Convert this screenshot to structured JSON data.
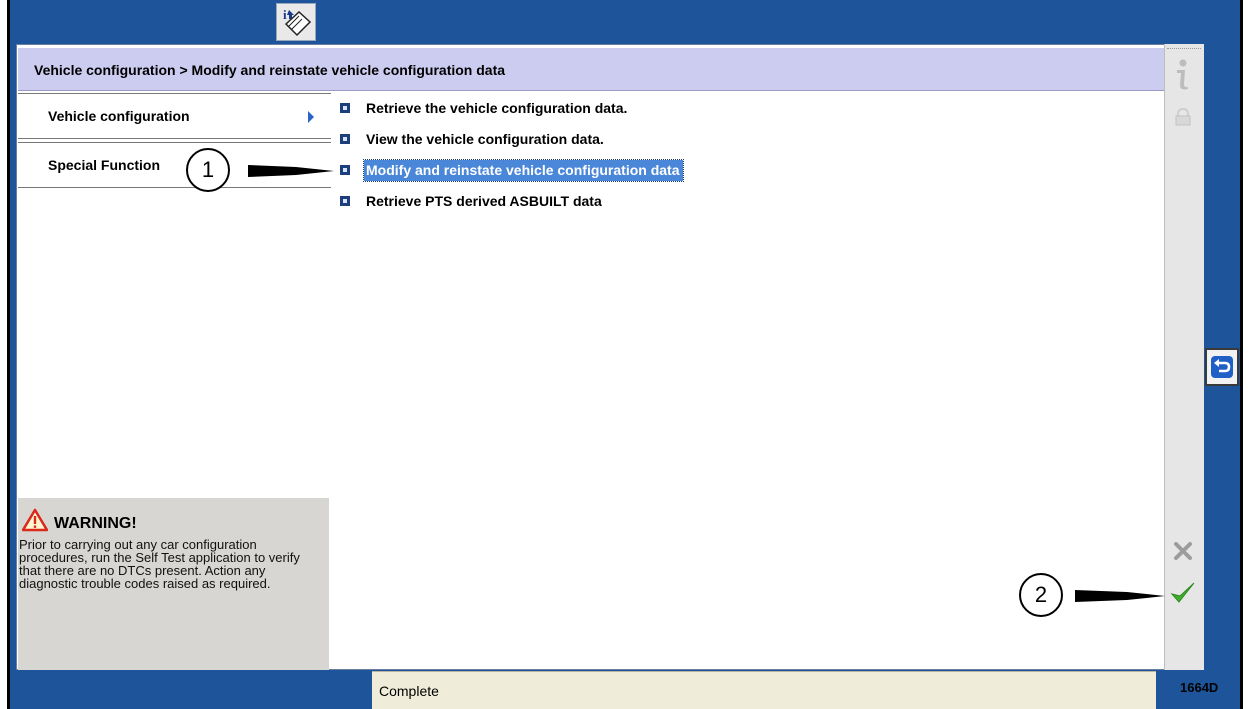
{
  "icons": {
    "toolbar": "book-info-icon",
    "info": "info-icon",
    "lock": "lock-icon",
    "warning": "warning-triangle-icon",
    "cancel": "cancel-x-icon",
    "confirm": "checkmark-icon",
    "return": "return-arrow-icon"
  },
  "header": {
    "breadcrumb": "Vehicle configuration > Modify and reinstate vehicle configuration data"
  },
  "tabs": [
    {
      "label": "Vehicle configuration"
    },
    {
      "label": "Special Function"
    }
  ],
  "menu": [
    {
      "label": "Retrieve the vehicle configuration data."
    },
    {
      "label": "View the vehicle configuration data."
    },
    {
      "label": "Modify and reinstate vehicle configuration data",
      "selected": true
    },
    {
      "label": "Retrieve PTS derived ASBUILT data"
    }
  ],
  "warning": {
    "title": "WARNING!",
    "body": "Prior to carrying out any car configuration procedures, run the Self Test application to verify that there are no DTCs present. Action any diagnostic trouble codes raised as required."
  },
  "callouts": [
    "1",
    "2"
  ],
  "status": {
    "text": "Complete"
  },
  "figure_id": "1664D",
  "colors": {
    "frame": "#1e5499",
    "header": "#ccccf0",
    "selection": "#4a87d9",
    "status": "#efedd9",
    "confirm": "#3fae2c"
  }
}
